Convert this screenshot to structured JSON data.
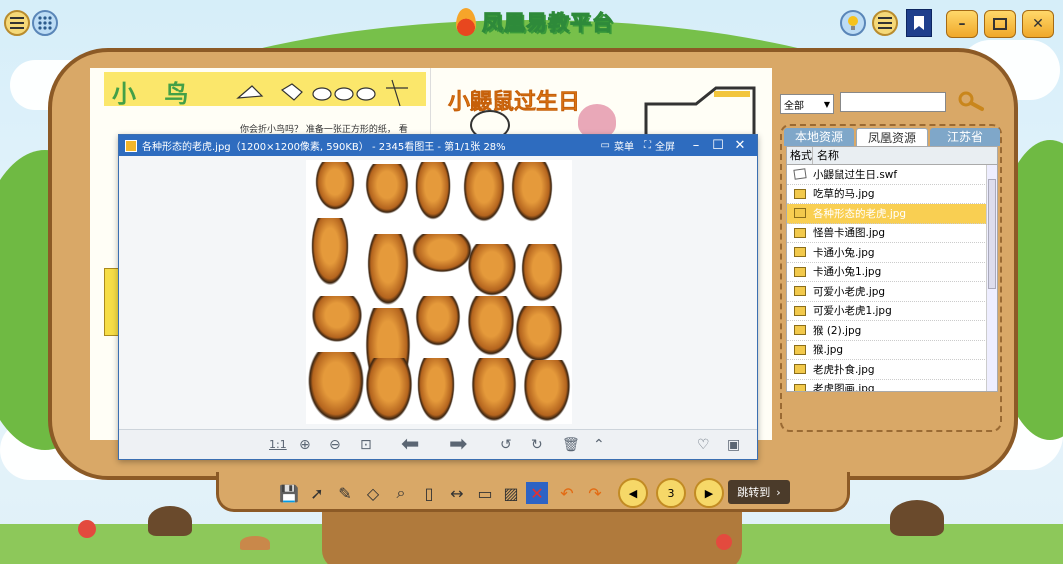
{
  "app": {
    "logo_text": "凤凰易教平台"
  },
  "book": {
    "left_title": "小 鸟",
    "left_text": "你会折小鸟吗？ 准备一张正方形的纸， 看",
    "right_title": "小鼹鼠过生日"
  },
  "viewer": {
    "title": "各种形态的老虎.jpg（1200×1200像素, 590KB） - 2345看图王 - 第1/1张 28%",
    "menu_label": "菜单",
    "fullscreen_label": "全屏",
    "ratio_label": "1:1"
  },
  "panel": {
    "filter_value": "全部",
    "search_value": "",
    "tabs": [
      "本地资源",
      "凤凰资源",
      "江苏省"
    ],
    "active_tab": 1,
    "col_format": "格式",
    "col_name": "名称",
    "files": [
      {
        "name": "小鼹鼠过生日.swf",
        "type": "swf",
        "selected": false
      },
      {
        "name": "吃草的马.jpg",
        "type": "jpg",
        "selected": false
      },
      {
        "name": "各种形态的老虎.jpg",
        "type": "jpg",
        "selected": true
      },
      {
        "name": "怪兽卡通图.jpg",
        "type": "jpg",
        "selected": false
      },
      {
        "name": "卡通小兔.jpg",
        "type": "jpg",
        "selected": false
      },
      {
        "name": "卡通小兔1.jpg",
        "type": "jpg",
        "selected": false
      },
      {
        "name": "可爱小老虎.jpg",
        "type": "jpg",
        "selected": false
      },
      {
        "name": "可爱小老虎1.jpg",
        "type": "jpg",
        "selected": false
      },
      {
        "name": "猴 (2).jpg",
        "type": "jpg",
        "selected": false
      },
      {
        "name": "猴.jpg",
        "type": "jpg",
        "selected": false
      },
      {
        "name": "老虎扑食.jpg",
        "type": "jpg",
        "selected": false
      },
      {
        "name": "老虎图画.jpg",
        "type": "jpg",
        "selected": false
      }
    ]
  },
  "toolbar": {
    "page_number": "3",
    "jump_label": "跳转到"
  },
  "colors": {
    "accent_yellow": "#f9cf52",
    "title_blue": "#2e6cbf",
    "board_brown": "#d9a867"
  }
}
